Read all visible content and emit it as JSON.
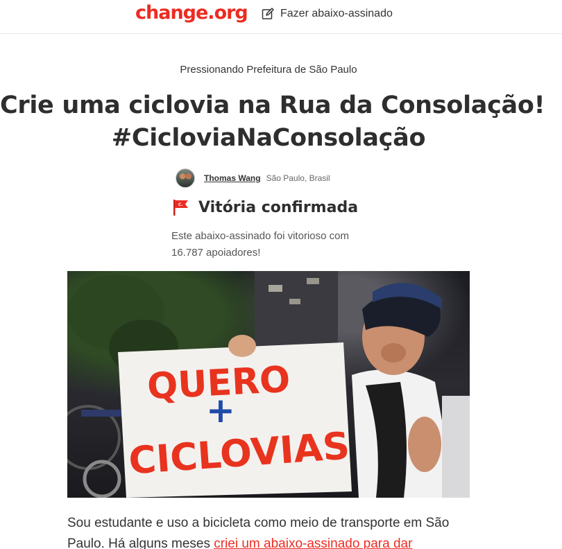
{
  "header": {
    "logo": "change.org",
    "start_petition_label": "Fazer abaixo-assinado"
  },
  "petition": {
    "target": "Pressionando Prefeitura de São Paulo",
    "title_line1": "Crie uma ciclovia na Rua da Consolação!",
    "title_line2": "#CicloviaNaConsolação",
    "author_name": "Thomas Wang",
    "author_location": "São Paulo, Brasil",
    "victory_label": "Vitória confirmada",
    "victory_description": "Este abaixo-assinado foi vitorioso com 16.787 apoiadores!",
    "photo": {
      "sign_line1": "QUERO",
      "sign_plus": "+",
      "sign_line2": "CICLOVIAS"
    },
    "body_start": "Sou estudante e uso a bicicleta como meio de transporte em São Paulo. Há alguns meses ",
    "body_link": "criei um abaixo-assinado para dar"
  },
  "colors": {
    "brand": "#ec2c22",
    "text": "#2e2e2e"
  },
  "icons": {
    "start_petition": "pencil-square-icon",
    "victory": "flag-icon"
  }
}
